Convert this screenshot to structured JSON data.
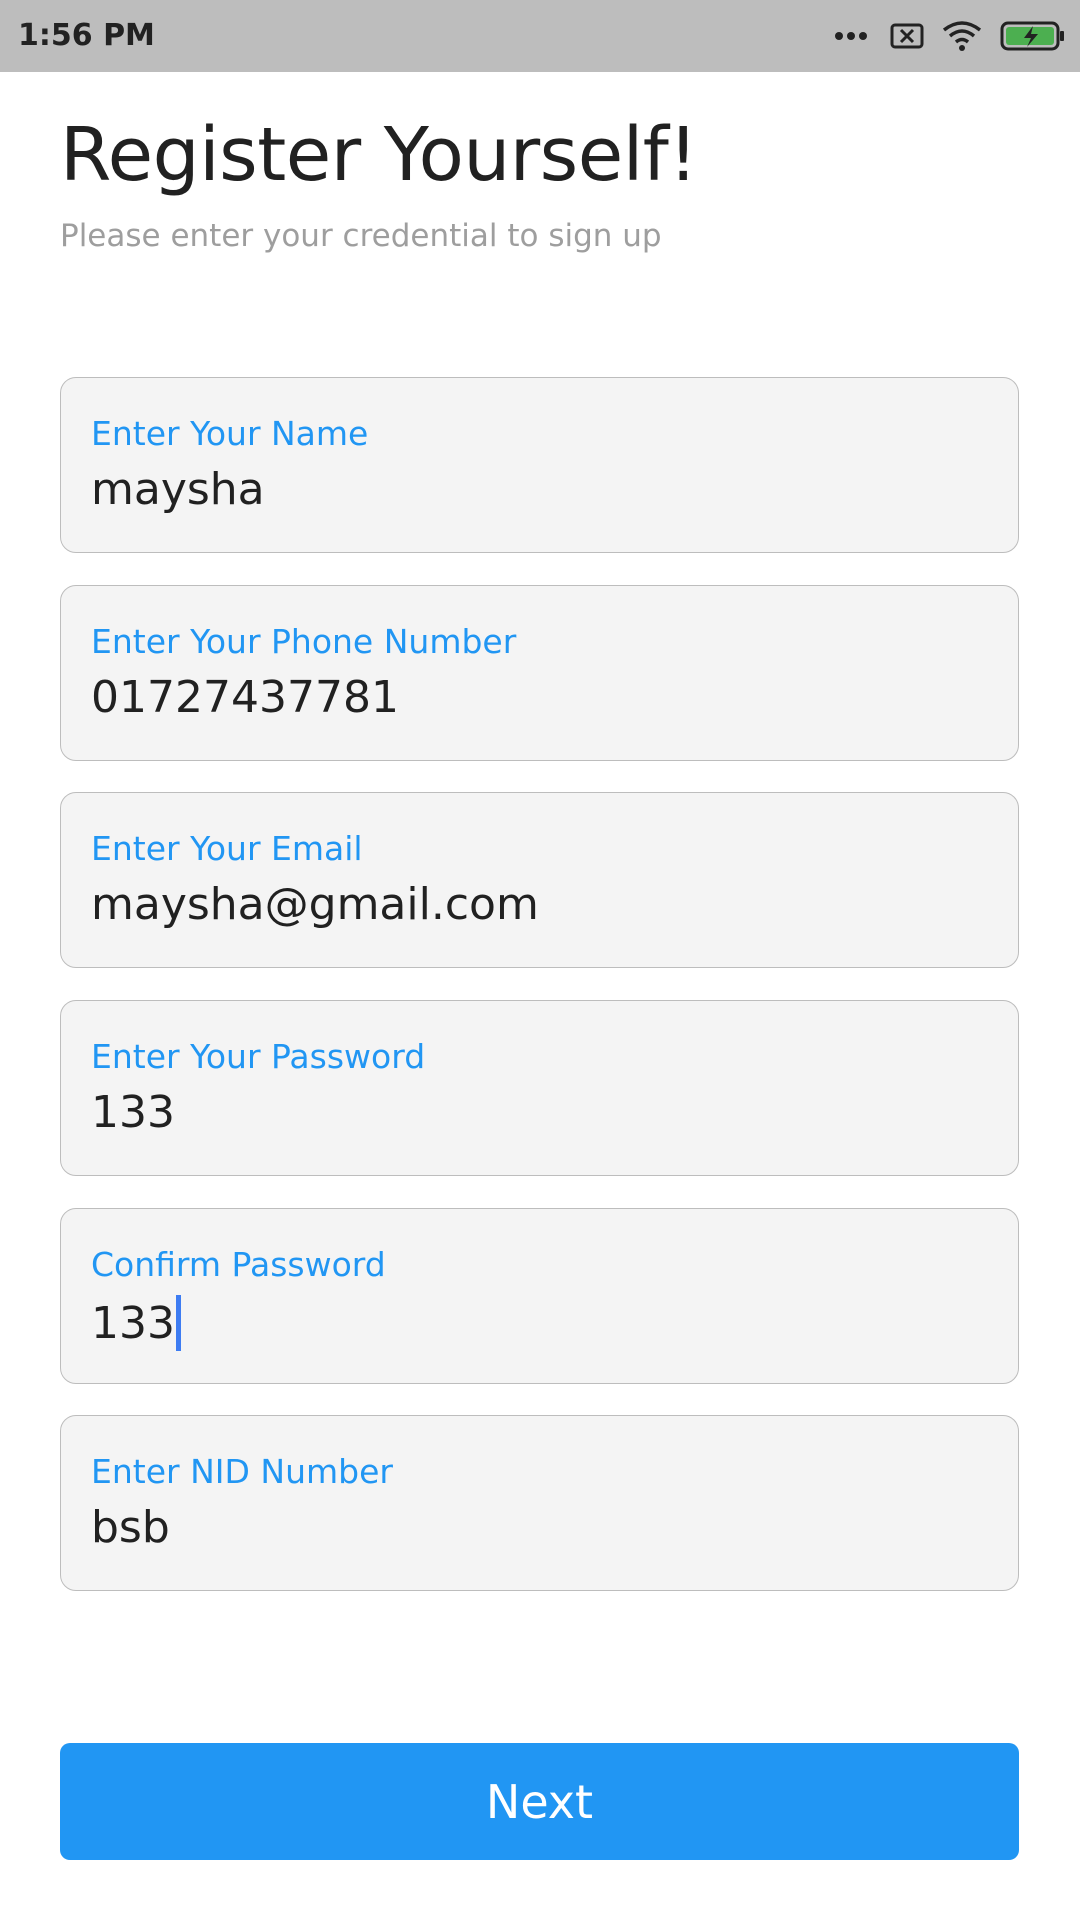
{
  "status_bar": {
    "time": "1:56 PM",
    "icons": [
      "more-dots-icon",
      "sim-error-icon",
      "wifi-icon",
      "battery-charging-icon"
    ]
  },
  "header": {
    "title": "Register Yourself!",
    "subtitle": "Please enter your credential to sign up"
  },
  "form": {
    "fields": [
      {
        "label": "Enter Your Name",
        "value": "maysha"
      },
      {
        "label": "Enter Your Phone Number",
        "value": "01727437781"
      },
      {
        "label": "Enter Your Email",
        "value": "maysha@gmail.com"
      },
      {
        "label": "Enter Your Password",
        "value": "133"
      },
      {
        "label": "Confirm Password",
        "value": "133",
        "focused": true
      },
      {
        "label": "Enter NID Number",
        "value": "bsb"
      }
    ]
  },
  "actions": {
    "next_label": "Next"
  },
  "colors": {
    "accent": "#2196f3",
    "status_bar": "#bdbdbd",
    "field_background": "#f4f4f4",
    "battery": "#4caf50"
  }
}
